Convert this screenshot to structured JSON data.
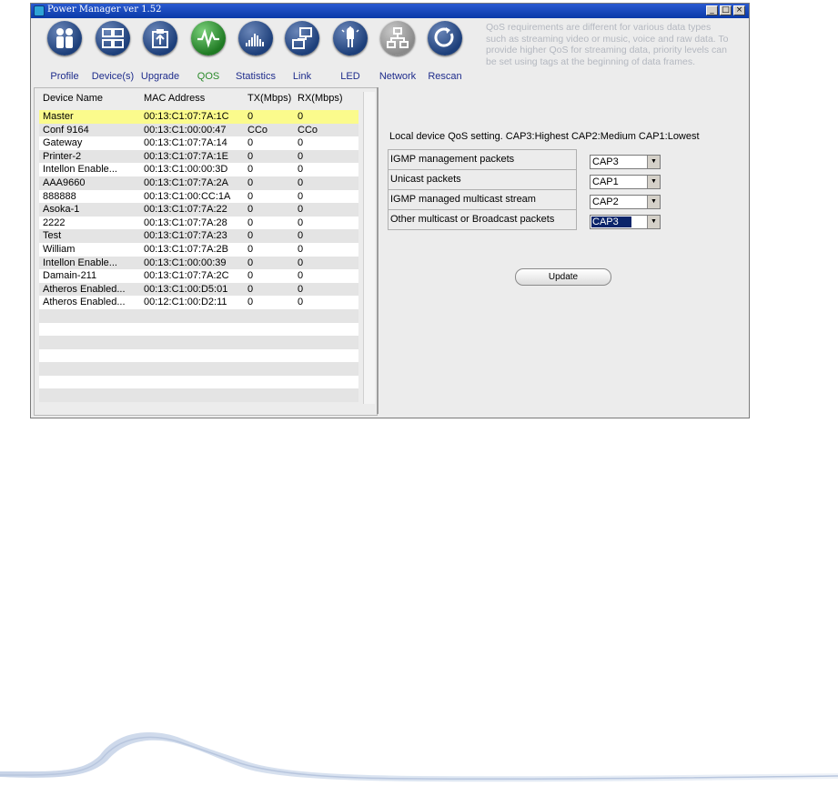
{
  "window": {
    "title": "Power Manager ver 1.52",
    "controls": [
      "minimize",
      "maximize",
      "close"
    ]
  },
  "toolbar": {
    "items": [
      {
        "label": "Profile",
        "icon": "profile-icon"
      },
      {
        "label": "Device(s)",
        "icon": "devices-icon"
      },
      {
        "label": "Upgrade",
        "icon": "upgrade-icon"
      },
      {
        "label": "QOS",
        "icon": "qos-icon",
        "active": true
      },
      {
        "label": "Statistics",
        "icon": "statistics-icon"
      },
      {
        "label": "Link",
        "icon": "link-icon"
      },
      {
        "label": "LED",
        "icon": "led-icon"
      },
      {
        "label": "Network",
        "icon": "network-icon"
      },
      {
        "label": "Rescan",
        "icon": "rescan-icon"
      }
    ],
    "description": "QoS requirements are different for various data types such as streaming video or music, voice and raw data. To provide higher QoS for streaming data, priority levels can be set using tags at the beginning of data frames."
  },
  "device_table": {
    "headers": [
      "Device Name",
      "MAC Address",
      "TX(Mbps)",
      "RX(Mbps)"
    ],
    "rows": [
      [
        "Master",
        "00:13:C1:07:7A:1C",
        "0",
        "0"
      ],
      [
        "Conf 9164",
        "00:13:C1:00:00:47",
        "CCo",
        "CCo"
      ],
      [
        "Gateway",
        "00:13:C1:07:7A:14",
        "0",
        "0"
      ],
      [
        "Printer-2",
        "00:13:C1:07:7A:1E",
        "0",
        "0"
      ],
      [
        "Intellon Enable...",
        "00:13:C1:00:00:3D",
        "0",
        "0"
      ],
      [
        "AAA9660",
        "00:13:C1:07:7A:2A",
        "0",
        "0"
      ],
      [
        "888888",
        "00:13:C1:00:CC:1A",
        "0",
        "0"
      ],
      [
        "Asoka-1",
        "00:13:C1:07:7A:22",
        "0",
        "0"
      ],
      [
        "2222",
        "00:13:C1:07:7A:28",
        "0",
        "0"
      ],
      [
        "Test",
        "00:13:C1:07:7A:23",
        "0",
        "0"
      ],
      [
        "William",
        "00:13:C1:07:7A:2B",
        "0",
        "0"
      ],
      [
        "Intellon Enable...",
        "00:13:C1:00:00:39",
        "0",
        "0"
      ],
      [
        "Damain-211",
        "00:13:C1:07:7A:2C",
        "0",
        "0"
      ],
      [
        "Atheros Enabled...",
        "00:13:C1:00:D5:01",
        "0",
        "0"
      ],
      [
        "Atheros Enabled...",
        "00:12:C1:00:D2:11",
        "0",
        "0"
      ]
    ],
    "selected_row": 0
  },
  "qos": {
    "title": "Local device QoS setting. CAP3:Highest CAP2:Medium CAP1:Lowest",
    "rows": [
      {
        "label": "IGMP management packets",
        "value": "CAP3"
      },
      {
        "label": "Unicast packets",
        "value": "CAP1"
      },
      {
        "label": "IGMP managed multicast stream",
        "value": "CAP2"
      },
      {
        "label": "Other multicast or Broadcast packets",
        "value": "CAP3"
      }
    ],
    "update_label": "Update"
  },
  "colors": {
    "titlebar": "#0a3aa8",
    "selected_row": "#fbfb8c",
    "toolbar_label": "#1e2c8c",
    "qos_active_label": "#2a8a2a",
    "dropdown_highlight": "#0a246a"
  }
}
